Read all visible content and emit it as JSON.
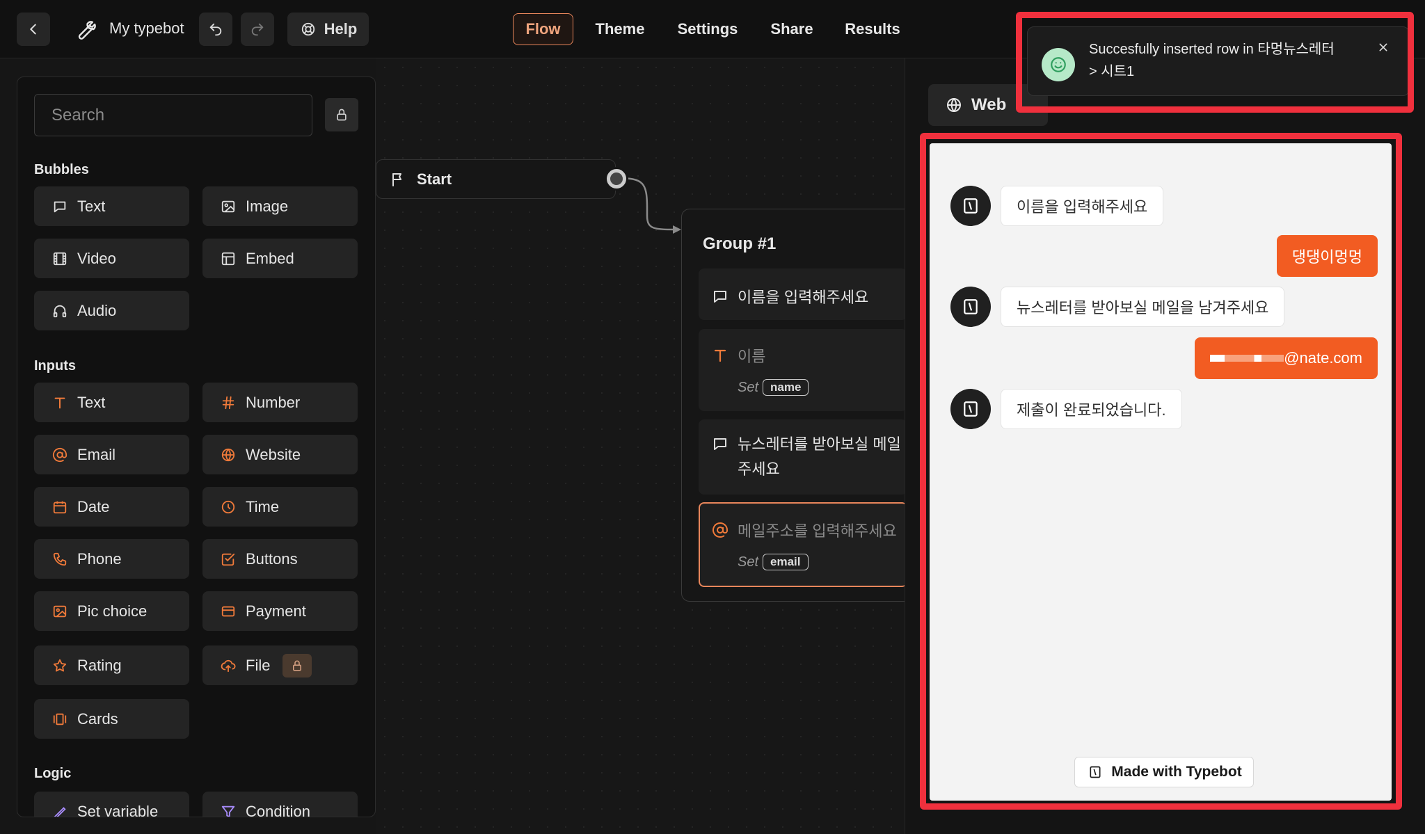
{
  "header": {
    "bot_name": "My typebot",
    "help_label": "Help",
    "tabs": [
      "Flow",
      "Theme",
      "Settings",
      "Share",
      "Results"
    ],
    "active_tab": "Flow"
  },
  "sidebar": {
    "search_placeholder": "Search",
    "sections": {
      "bubbles": "Bubbles",
      "inputs": "Inputs",
      "logic": "Logic"
    },
    "bubbles": [
      "Text",
      "Image",
      "Video",
      "Embed",
      "Audio"
    ],
    "inputs": [
      "Text",
      "Number",
      "Email",
      "Website",
      "Date",
      "Time",
      "Phone",
      "Buttons",
      "Pic choice",
      "Payment",
      "Rating",
      "File",
      "Cards"
    ],
    "logic": [
      "Set variable",
      "Condition"
    ]
  },
  "canvas": {
    "start_label": "Start",
    "group_title": "Group #1",
    "blocks": {
      "b1": "이름을 입력해주세요",
      "b2_placeholder": "이름",
      "b2_set": "Set",
      "b2_var": "name",
      "b3_line1": "뉴스레터를 받아보실 메일",
      "b3_line2": "주세요",
      "b4_placeholder": "메일주소를 입력해주세요",
      "b4_set": "Set",
      "b4_var": "email"
    }
  },
  "preview": {
    "web_tab": "Web",
    "messages": {
      "bot1": "이름을 입력해주세요",
      "user1": "댕댕이멍멍",
      "bot2": "뉴스레터를 받아보실 메일을 남겨주세요",
      "user2_domain": "@nate.com",
      "bot3": "제출이 완료되었습니다."
    },
    "made_with": "Made with Typebot"
  },
  "toast": {
    "line1": "Succesfully inserted row in 타멍뉴스레터",
    "line2": "> 시트1"
  },
  "colors": {
    "accent": "#f25c22",
    "highlight": "#f0303d",
    "toast_icon": "#b6e9c8"
  }
}
